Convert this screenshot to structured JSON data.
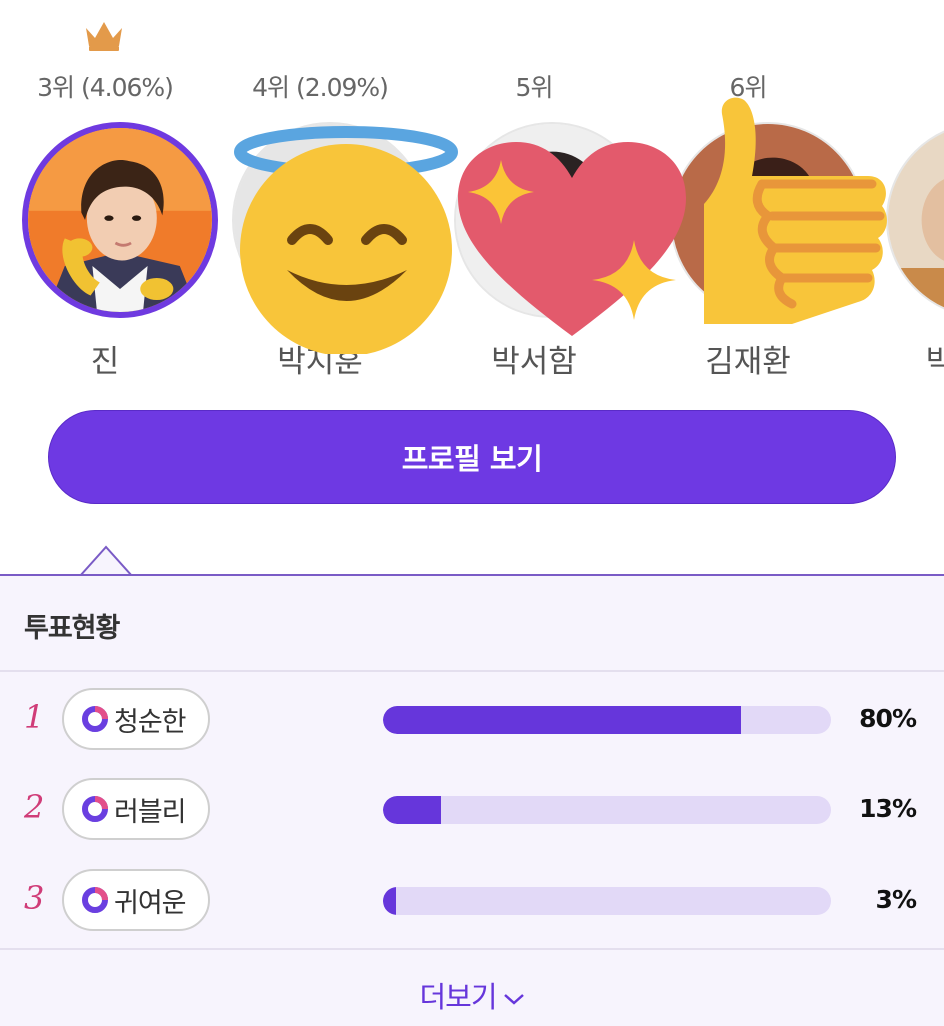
{
  "ranking": {
    "cards": [
      {
        "rank_label": "3위 (4.06%)",
        "name": "진",
        "icon": "crown-icon"
      },
      {
        "rank_label": "4위 (2.09%)",
        "name": "박지훈",
        "emoji": "smiling-face-with-halo"
      },
      {
        "rank_label": "5위",
        "name": "박서함",
        "emoji": "sparkling-heart"
      },
      {
        "rank_label": "6위",
        "name": "김재환",
        "emoji": "thumbs-up"
      },
      {
        "rank_label": "",
        "name": "박"
      }
    ]
  },
  "profile_button": {
    "label": "프로필 보기"
  },
  "vote_status": {
    "title": "투표현황",
    "rows": [
      {
        "rank": "1",
        "name": "청순한",
        "percent_label": "80%",
        "percent": 80
      },
      {
        "rank": "2",
        "name": "러블리",
        "percent_label": "13%",
        "percent": 13
      },
      {
        "rank": "3",
        "name": "귀여운",
        "percent_label": "3%",
        "percent": 3
      }
    ],
    "more_label": "더보기"
  },
  "colors": {
    "accent": "#6e39e3",
    "bar_fill": "#6636db",
    "bar_track": "#e2d9f7",
    "rank_number": "#d03c78"
  }
}
